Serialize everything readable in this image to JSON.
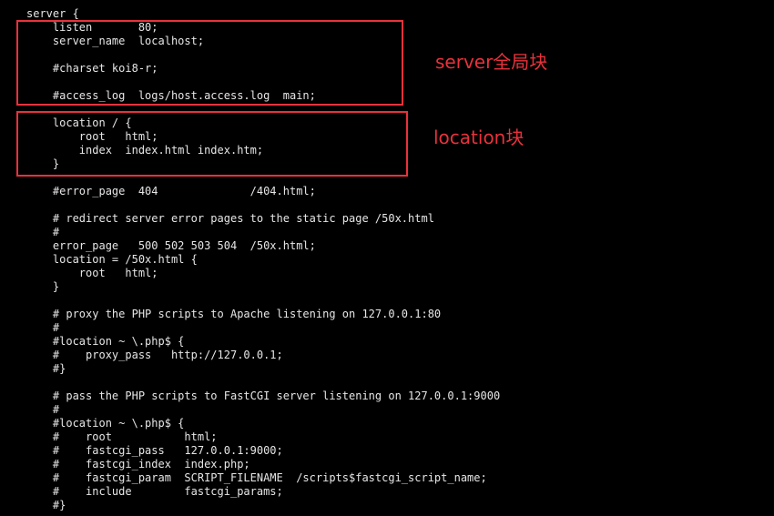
{
  "terminal": {
    "lines": [
      "server {",
      "    listen       80;",
      "    server_name  localhost;",
      "",
      "    #charset koi8-r;",
      "",
      "    #access_log  logs/host.access.log  main;",
      "",
      "    location / {",
      "        root   html;",
      "        index  index.html index.htm;",
      "    }",
      "",
      "    #error_page  404              /404.html;",
      "",
      "    # redirect server error pages to the static page /50x.html",
      "    #",
      "    error_page   500 502 503 504  /50x.html;",
      "    location = /50x.html {",
      "        root   html;",
      "    }",
      "",
      "    # proxy the PHP scripts to Apache listening on 127.0.0.1:80",
      "    #",
      "    #location ~ \\.php$ {",
      "    #    proxy_pass   http://127.0.0.1;",
      "    #}",
      "",
      "    # pass the PHP scripts to FastCGI server listening on 127.0.0.1:9000",
      "    #",
      "    #location ~ \\.php$ {",
      "    #    root           html;",
      "    #    fastcgi_pass   127.0.0.1:9000;",
      "    #    fastcgi_index  index.php;",
      "    #    fastcgi_param  SCRIPT_FILENAME  /scripts$fastcgi_script_name;",
      "    #    include        fastcgi_params;",
      "    #}"
    ]
  },
  "annotations": {
    "server_block": "server全局块",
    "location_block": "location块"
  },
  "colors": {
    "background": "#000000",
    "text": "#e6e6e6",
    "highlight": "#e8323c"
  }
}
